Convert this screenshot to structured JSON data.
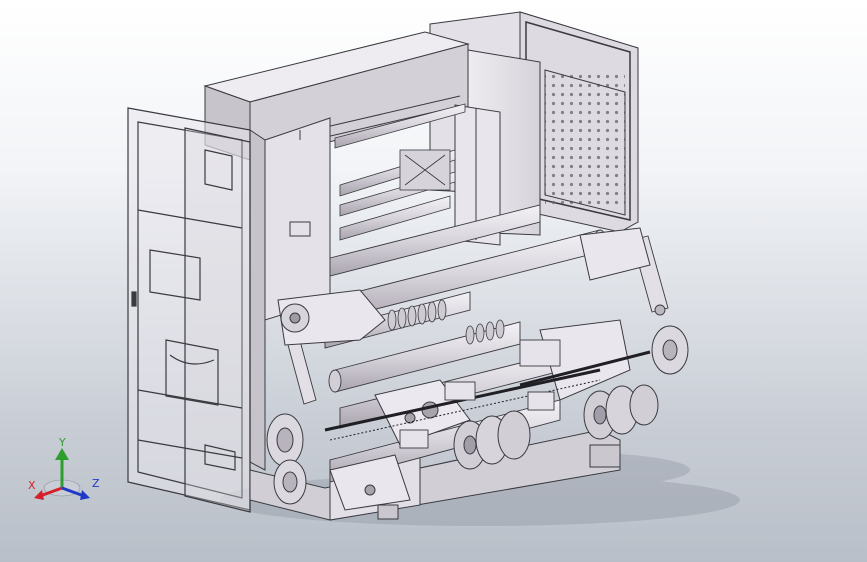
{
  "triad": {
    "x_label": "X",
    "y_label": "Y",
    "z_label": "Z",
    "x_color": "#d4202a",
    "y_color": "#2e9e2e",
    "z_color": "#2038c8"
  },
  "colors": {
    "background_top": "#ffffff",
    "background_bottom": "#b9bfc8",
    "frame_light": "#e7e4ea",
    "frame_shade": "#c9c4cd",
    "line": "#3a3a40"
  }
}
